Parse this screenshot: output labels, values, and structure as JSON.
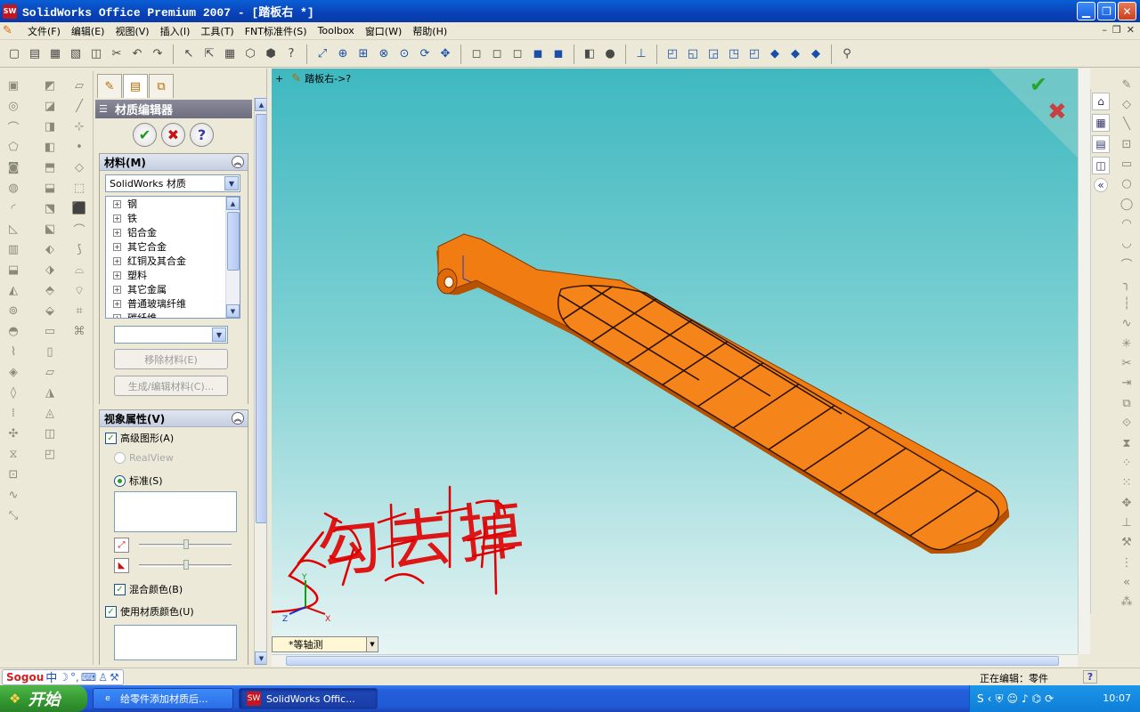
{
  "window": {
    "title": "SolidWorks Office Premium 2007 - [踏板右 *]",
    "logo": "SW",
    "buttons": [
      "minimize",
      "restore",
      "close"
    ]
  },
  "menu": {
    "items": [
      "文件(F)",
      "编辑(E)",
      "视图(V)",
      "插入(I)",
      "工具(T)",
      "FNT标准件(S)",
      "Toolbox",
      "窗口(W)",
      "帮助(H)"
    ]
  },
  "property_manager": {
    "title": "材质编辑器",
    "actions": {
      "ok": "✔",
      "cancel": "✖",
      "help": "?"
    },
    "material_group": {
      "label": "材料(M)",
      "library_value": "SolidWorks 材质",
      "tree_items": [
        "钢",
        "铁",
        "铝合金",
        "其它合金",
        "红铜及其合金",
        "塑料",
        "其它金属",
        "普通玻璃纤维",
        "碳纤维"
      ],
      "combo_value": "",
      "remove_button": "移除材料(E)",
      "edit_button": "生成/编辑材料(C)..."
    },
    "visual_group": {
      "label": "视象属性(V)",
      "advanced_graphics": "高级图形(A)",
      "realview": "RealView",
      "standard": "标准(S)",
      "blend_color": "混合颜色(B)",
      "use_material_color": "使用材质颜色(U)"
    }
  },
  "graphics": {
    "feature_tree_label": "踏板右->?",
    "view_orientation": "*等轴测",
    "annotation_text": "勾去掉",
    "triad_labels": {
      "x": "X",
      "y": "Y",
      "z": "Z"
    },
    "colors": {
      "part": "#f07c12",
      "part_dark": "#b85200",
      "background_top": "#3fb8c0",
      "background_bottom": "#e8f4f4",
      "annotation": "#e00000"
    }
  },
  "status": {
    "ime_logo": "Sogou",
    "ime_mode": "中",
    "editing_text": "正在编辑：零件"
  },
  "taskbar": {
    "start_label": "开始",
    "tasks": [
      "给零件添加材质后...",
      "SolidWorks Offic..."
    ],
    "clock": "10:07"
  }
}
